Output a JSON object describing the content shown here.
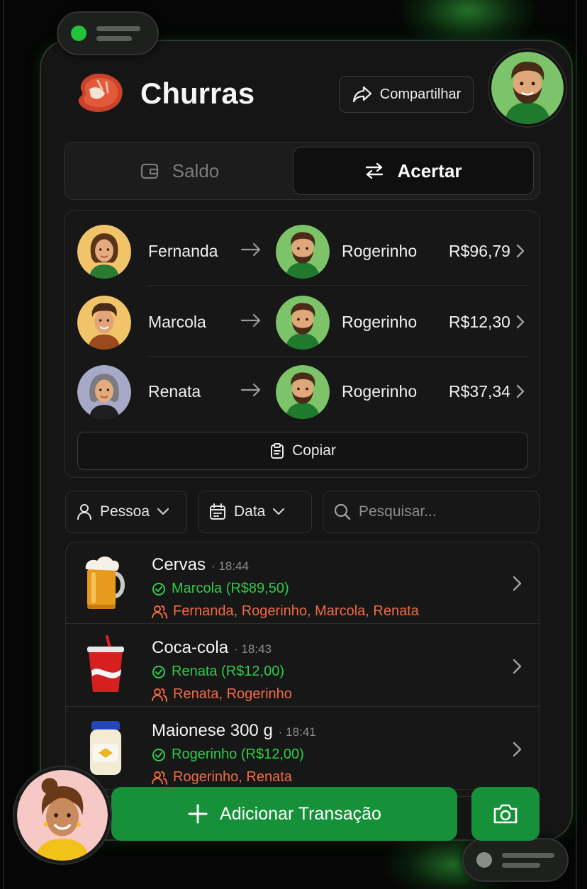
{
  "header": {
    "title": "Churras",
    "share_label": "Compartilhar"
  },
  "tabs": [
    {
      "label": "Saldo",
      "active": false
    },
    {
      "label": "Acertar",
      "active": true
    }
  ],
  "settlements": [
    {
      "from": "Fernanda",
      "to": "Rogerinho",
      "amount": "R$96,79"
    },
    {
      "from": "Marcola",
      "to": "Rogerinho",
      "amount": "R$12,30"
    },
    {
      "from": "Renata",
      "to": "Rogerinho",
      "amount": "R$37,34"
    }
  ],
  "copy_label": "Copiar",
  "filters": {
    "person_label": "Pessoa",
    "date_label": "Data",
    "search_placeholder": "Pesquisar..."
  },
  "transactions": [
    {
      "name": "Cervas",
      "time": "· 18:44",
      "payer": "Marcola (R$89,50)",
      "participants": "Fernanda, Rogerinho, Marcola, Renata",
      "icon": "beer-mug-icon"
    },
    {
      "name": "Coca-cola",
      "time": "· 18:43",
      "payer": "Renata (R$12,00)",
      "participants": "Renata, Rogerinho",
      "icon": "soda-cup-icon"
    },
    {
      "name": "Maionese 300 g",
      "time": "· 18:41",
      "payer": "Rogerinho (R$12,00)",
      "participants": "Rogerinho, Renata",
      "icon": "mayonnaise-jar-icon"
    }
  ],
  "add_transaction_label": "Adicionar Transação",
  "colors": {
    "accent_green": "#17903a",
    "payer_green": "#2ecc4a",
    "participants_orange": "#f06a45",
    "background": "#141514"
  }
}
